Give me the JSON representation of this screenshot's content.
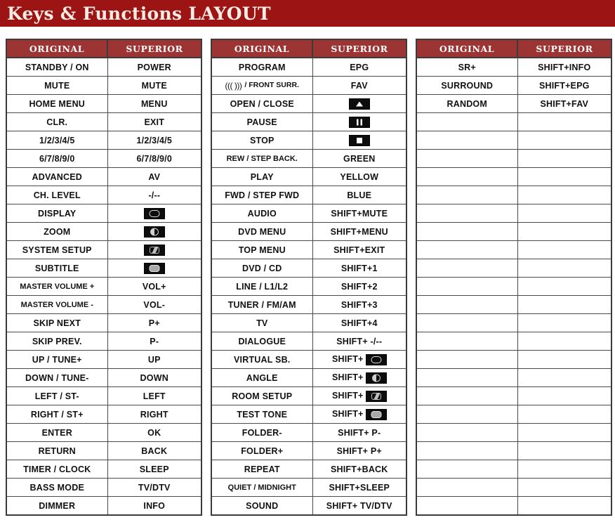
{
  "banner": {
    "title": "Keys & Functions LAYOUT",
    "background_color": "#9d1414",
    "text_color": "#f7ece4"
  },
  "theme": {
    "header_red": "#9d3434",
    "border": "#4a4a4a",
    "chip_background": "#0d0d0d"
  },
  "columns": {
    "original": "ORIGINAL",
    "superior": "SUPERIOR"
  },
  "tables": [
    {
      "name": "table-1",
      "rows": [
        {
          "original": "STANDBY / ON",
          "superior": "POWER"
        },
        {
          "original": "MUTE",
          "superior": "MUTE"
        },
        {
          "original": "HOME MENU",
          "superior": "MENU"
        },
        {
          "original": "CLR.",
          "superior": "EXIT"
        },
        {
          "original": "1/2/3/4/5",
          "superior": "1/2/3/4/5"
        },
        {
          "original": "6/7/8/9/0",
          "superior": "6/7/8/9/0"
        },
        {
          "original": "ADVANCED",
          "superior": "AV"
        },
        {
          "original": "CH. LEVEL",
          "superior": "-/--"
        },
        {
          "original": "DISPLAY",
          "superior": "",
          "superior_icon": "display-button-icon"
        },
        {
          "original": "ZOOM",
          "superior": "",
          "superior_icon": "zoom-button-icon"
        },
        {
          "original": "SYSTEM SETUP",
          "superior": "",
          "superior_icon": "system-setup-button-icon"
        },
        {
          "original": "SUBTITLE",
          "superior": "",
          "superior_icon": "subtitle-button-icon"
        },
        {
          "original": "MASTER VOLUME +",
          "superior": "VOL+"
        },
        {
          "original": "MASTER VOLUME -",
          "superior": "VOL-"
        },
        {
          "original": "SKIP NEXT",
          "superior": "P+"
        },
        {
          "original": "SKIP PREV.",
          "superior": "P-"
        },
        {
          "original": "UP / TUNE+",
          "superior": "UP"
        },
        {
          "original": "DOWN / TUNE-",
          "superior": "DOWN"
        },
        {
          "original": "LEFT / ST-",
          "superior": "LEFT"
        },
        {
          "original": "RIGHT / ST+",
          "superior": "RIGHT"
        },
        {
          "original": "ENTER",
          "superior": "OK"
        },
        {
          "original": "RETURN",
          "superior": "BACK"
        },
        {
          "original": "TIMER / CLOCK",
          "superior": "SLEEP"
        },
        {
          "original": "BASS MODE",
          "superior": "TV/DTV"
        },
        {
          "original": "DIMMER",
          "superior": "INFO"
        }
      ]
    },
    {
      "name": "table-2",
      "rows": [
        {
          "original": "PROGRAM",
          "superior": "EPG"
        },
        {
          "original": "/ FRONT SURR.",
          "original_icon": "surround-waves-icon",
          "superior": "FAV"
        },
        {
          "original": "OPEN / CLOSE",
          "superior": "",
          "superior_icon": "eject-button-icon"
        },
        {
          "original": "PAUSE",
          "superior": "",
          "superior_icon": "pause-button-icon"
        },
        {
          "original": "STOP",
          "superior": "",
          "superior_icon": "stop-button-icon"
        },
        {
          "original": "REW / STEP BACK.",
          "superior": "GREEN"
        },
        {
          "original": "PLAY",
          "superior": "YELLOW"
        },
        {
          "original": "FWD / STEP FWD",
          "superior": "BLUE"
        },
        {
          "original": "AUDIO",
          "superior": "SHIFT+MUTE"
        },
        {
          "original": "DVD MENU",
          "superior": "SHIFT+MENU"
        },
        {
          "original": "TOP MENU",
          "superior": "SHIFT+EXIT"
        },
        {
          "original": "DVD / CD",
          "superior": "SHIFT+1"
        },
        {
          "original": "LINE / L1/L2",
          "superior": "SHIFT+2"
        },
        {
          "original": "TUNER / FM/AM",
          "superior": "SHIFT+3"
        },
        {
          "original": "TV",
          "superior": "SHIFT+4"
        },
        {
          "original": "DIALOGUE",
          "superior": "SHIFT+ -/--"
        },
        {
          "original": "VIRTUAL SB.",
          "superior": "SHIFT+",
          "superior_icon": "display-button-icon"
        },
        {
          "original": "ANGLE",
          "superior": "SHIFT+",
          "superior_icon": "zoom-button-icon"
        },
        {
          "original": "ROOM SETUP",
          "superior": "SHIFT+",
          "superior_icon": "system-setup-button-icon"
        },
        {
          "original": "TEST TONE",
          "superior": "SHIFT+",
          "superior_icon": "subtitle-button-icon"
        },
        {
          "original": "FOLDER-",
          "superior": "SHIFT+ P-"
        },
        {
          "original": "FOLDER+",
          "superior": "SHIFT+ P+"
        },
        {
          "original": "REPEAT",
          "superior": "SHIFT+BACK"
        },
        {
          "original": "QUIET / MIDNIGHT",
          "superior": "SHIFT+SLEEP"
        },
        {
          "original": "SOUND",
          "superior": "SHIFT+ TV/DTV"
        }
      ]
    },
    {
      "name": "table-3",
      "rows": [
        {
          "original": "SR+",
          "superior": "SHIFT+INFO"
        },
        {
          "original": "SURROUND",
          "superior": "SHIFT+EPG"
        },
        {
          "original": "RANDOM",
          "superior": "SHIFT+FAV"
        },
        {
          "original": "",
          "superior": ""
        },
        {
          "original": "",
          "superior": ""
        },
        {
          "original": "",
          "superior": ""
        },
        {
          "original": "",
          "superior": ""
        },
        {
          "original": "",
          "superior": ""
        },
        {
          "original": "",
          "superior": ""
        },
        {
          "original": "",
          "superior": ""
        },
        {
          "original": "",
          "superior": ""
        },
        {
          "original": "",
          "superior": ""
        },
        {
          "original": "",
          "superior": ""
        },
        {
          "original": "",
          "superior": ""
        },
        {
          "original": "",
          "superior": ""
        },
        {
          "original": "",
          "superior": ""
        },
        {
          "original": "",
          "superior": ""
        },
        {
          "original": "",
          "superior": ""
        },
        {
          "original": "",
          "superior": ""
        },
        {
          "original": "",
          "superior": ""
        },
        {
          "original": "",
          "superior": ""
        },
        {
          "original": "",
          "superior": ""
        },
        {
          "original": "",
          "superior": ""
        },
        {
          "original": "",
          "superior": ""
        },
        {
          "original": "",
          "superior": ""
        }
      ]
    }
  ]
}
